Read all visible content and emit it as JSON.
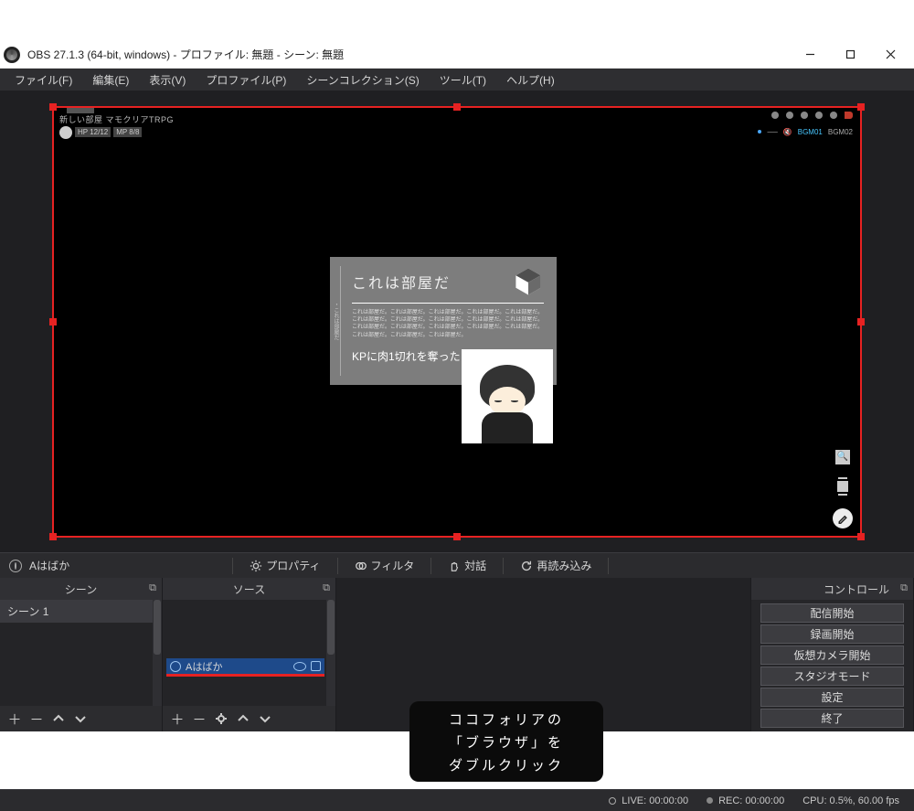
{
  "titlebar": {
    "title": "OBS 27.1.3 (64-bit, windows) - プロファイル: 無題 - シーン: 無題"
  },
  "menu": {
    "file": "ファイル(F)",
    "edit": "編集(E)",
    "view": "表示(V)",
    "profile": "プロファイル(P)",
    "scenecol": "シーンコレクション(S)",
    "tools": "ツール(T)",
    "help": "ヘルプ(H)"
  },
  "preview": {
    "room_title": "新しい部屋 マモクリアTRPG",
    "hp": "HP  12/12",
    "mp": "MP  8/8",
    "bgm1": "BGM01",
    "bgm2": "BGM02",
    "card_title": "これは部屋だ",
    "card_body": "これは部屋だ。これは部屋だ。これは部屋だ。これは部屋だ。これは部屋だ。これは部屋だ。これは部屋だ。これは部屋だ。これは部屋だ。これは部屋だ。これは部屋だ。これは部屋だ。これは部屋だ。これは部屋だ。これは部屋だ。これは部屋だ。これは部屋だ。これは部屋だ。",
    "card_foot": "KPに肉1切れを奪った",
    "card_side": "・これは部屋だ"
  },
  "context": {
    "source_name": "Aはばか",
    "properties": "プロパティ",
    "filters": "フィルタ",
    "interact": "対話",
    "reload": "再読み込み"
  },
  "docks": {
    "scenes_title": "シーン",
    "sources_title": "ソース",
    "controls_title": "コントロール",
    "scene1": "シーン 1",
    "source1": "Aはばか"
  },
  "controls": {
    "start_stream": "配信開始",
    "start_record": "録画開始",
    "vcam": "仮想カメラ開始",
    "studio": "スタジオモード",
    "settings": "設定",
    "exit": "終了"
  },
  "status": {
    "live": "LIVE: 00:00:00",
    "rec": "REC: 00:00:00",
    "cpu": "CPU: 0.5%, 60.00 fps"
  },
  "annotation": {
    "line1": "ココフォリアの",
    "line2": "「ブラウザ」を",
    "line3": "ダブルクリック"
  }
}
